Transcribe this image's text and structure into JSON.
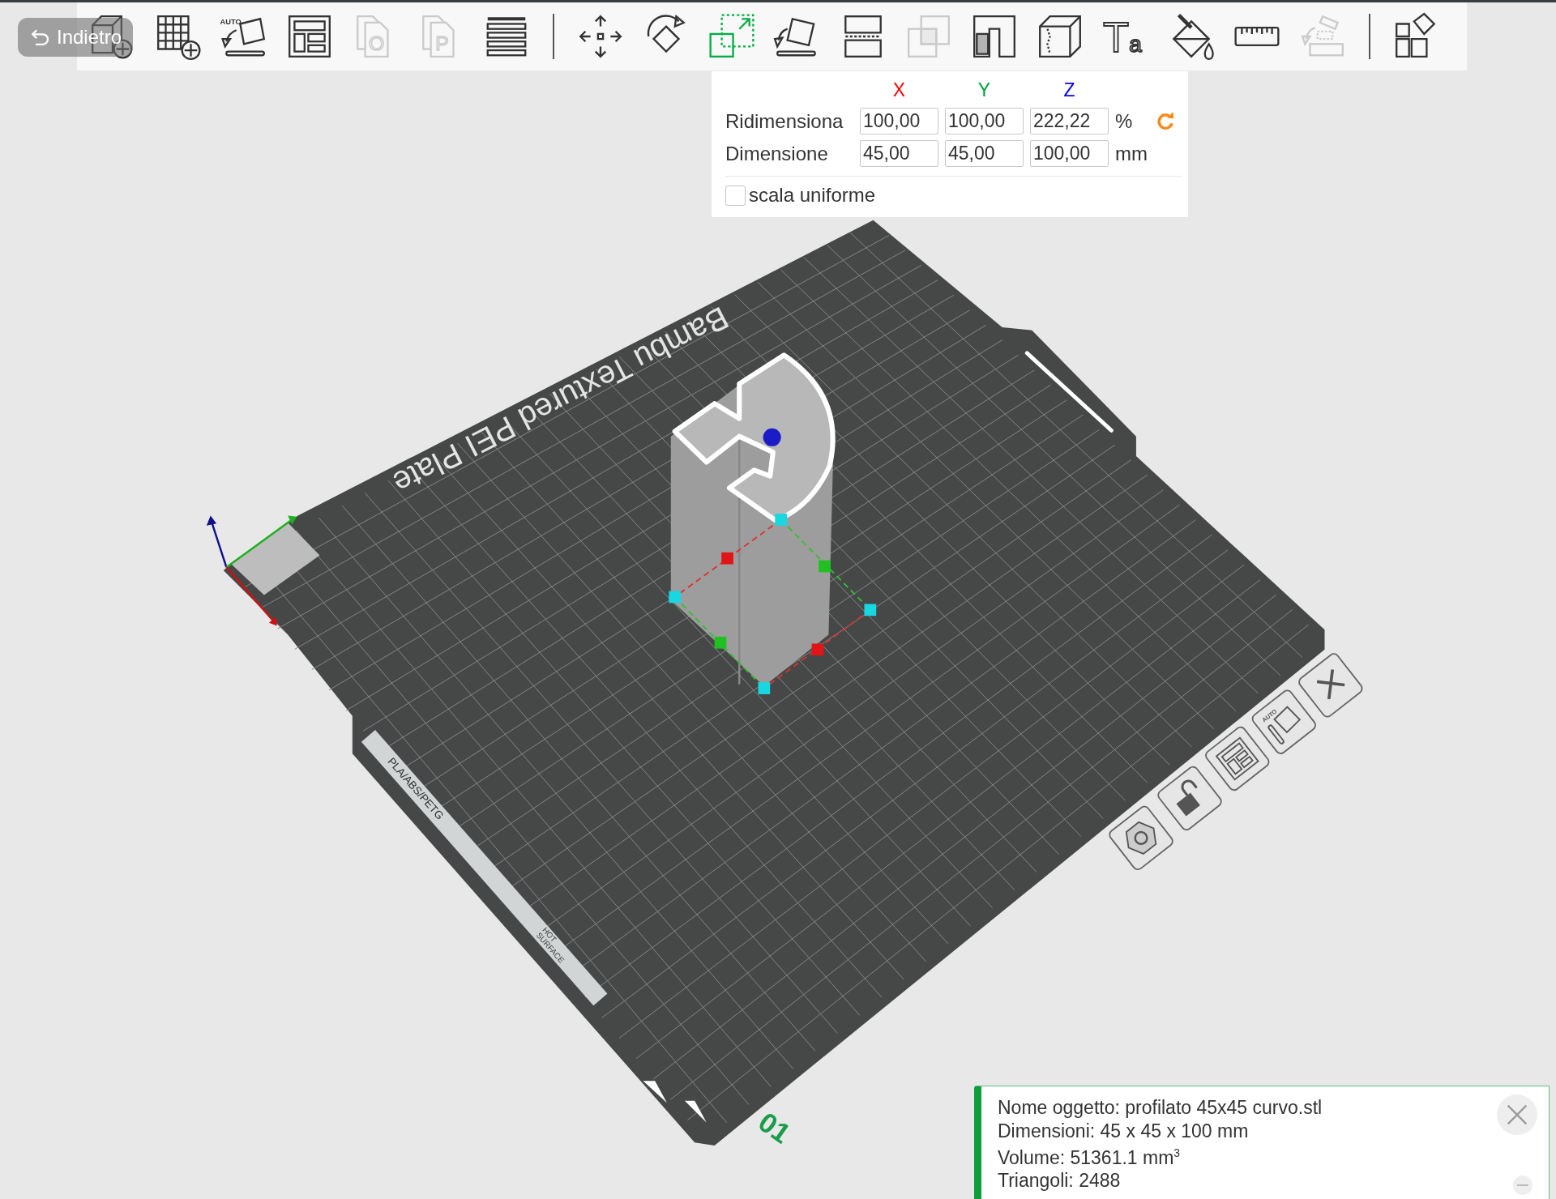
{
  "toolbar": {
    "back_button": "Indietro",
    "tools": [
      {
        "kind": "add-object",
        "disabled": false,
        "selected": false
      },
      {
        "kind": "add-plate",
        "disabled": false,
        "selected": false
      },
      {
        "kind": "auto-orient",
        "glyph": "AUTO",
        "disabled": false,
        "selected": false
      },
      {
        "kind": "arrange",
        "disabled": false,
        "selected": false
      },
      {
        "kind": "copy",
        "glyph": "O",
        "disabled": true,
        "selected": false
      },
      {
        "kind": "copy",
        "glyph": "P",
        "disabled": true,
        "selected": false
      },
      {
        "kind": "layers",
        "disabled": false,
        "selected": false
      },
      {
        "kind": "divider"
      },
      {
        "kind": "move",
        "disabled": false,
        "selected": false
      },
      {
        "kind": "rotate",
        "disabled": false,
        "selected": false
      },
      {
        "kind": "scale",
        "disabled": false,
        "selected": true
      },
      {
        "kind": "lay-flat",
        "disabled": false,
        "selected": false
      },
      {
        "kind": "cut",
        "disabled": false,
        "selected": false
      },
      {
        "kind": "boolean",
        "disabled": true,
        "selected": false
      },
      {
        "kind": "support",
        "disabled": false,
        "selected": false
      },
      {
        "kind": "seam",
        "disabled": false,
        "selected": false
      },
      {
        "kind": "text",
        "glyph": "Ta",
        "disabled": false,
        "selected": false
      },
      {
        "kind": "paint",
        "disabled": false,
        "selected": false
      },
      {
        "kind": "measure",
        "disabled": false,
        "selected": false
      },
      {
        "kind": "assembly",
        "disabled": true,
        "selected": false
      },
      {
        "kind": "divider"
      },
      {
        "kind": "split",
        "disabled": false,
        "selected": false
      }
    ]
  },
  "scale_panel": {
    "axes": [
      {
        "label": "X",
        "color": "#ff0000"
      },
      {
        "label": "Y",
        "color": "#00a040"
      },
      {
        "label": "Z",
        "color": "#0000ff"
      }
    ],
    "rows": [
      {
        "label": "Ridimensiona",
        "values": [
          "100,00",
          "100,00",
          "222,22"
        ],
        "unit": "%"
      },
      {
        "label": "Dimensione",
        "values": [
          "45,00",
          "45,00",
          "100,00"
        ],
        "unit": "mm"
      }
    ],
    "uniform_scale": {
      "label": "scala uniforme",
      "checked": false
    }
  },
  "plate": {
    "name": "Bambu Textured PEI Plate",
    "material": "PLA/ABS/PETG",
    "warning": [
      "HOT",
      "SURFACE"
    ],
    "number": "01",
    "buttons": [
      {
        "kind": "close"
      },
      {
        "kind": "auto-orient",
        "glyph": "AUTO"
      },
      {
        "kind": "arrange"
      },
      {
        "kind": "lock"
      },
      {
        "kind": "nut"
      }
    ]
  },
  "info": {
    "lines": [
      "Nome oggetto: profilato 45x45 curvo.stl",
      "Dimensioni: 45 x 45 x 100 mm",
      "Volume: 51361.1 mm$^{3}$",
      "Triangoli: 2488"
    ]
  }
}
